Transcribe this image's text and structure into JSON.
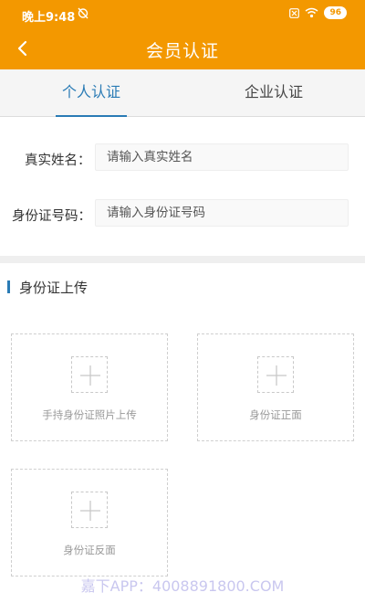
{
  "status_bar": {
    "time": "晚上9:48",
    "battery": "96",
    "left_icon": "alarm-off-icon",
    "right_icons": [
      "sim-icon",
      "wifi-icon",
      "battery-icon"
    ]
  },
  "header": {
    "title": "会员认证",
    "back_icon": "chevron-left-icon",
    "background": "#f39800"
  },
  "tabs": [
    {
      "label": "个人认证",
      "active": true
    },
    {
      "label": "企业认证",
      "active": false
    }
  ],
  "accent_color": "#2a7bb5",
  "form": {
    "real_name": {
      "label": "真实姓名：",
      "placeholder": "请输入真实姓名",
      "value": ""
    },
    "id_number": {
      "label": "身份证号码：",
      "placeholder": "请输入身份证号码",
      "value": ""
    }
  },
  "upload_section": {
    "title": "身份证上传",
    "slots": [
      {
        "label": "手持身份证照片上传",
        "icon": "plus-icon"
      },
      {
        "label": "身份证正面",
        "icon": "plus-icon"
      },
      {
        "label": "身份证反面",
        "icon": "plus-icon"
      }
    ]
  },
  "watermark": "嘉下APP：4008891800.COM"
}
